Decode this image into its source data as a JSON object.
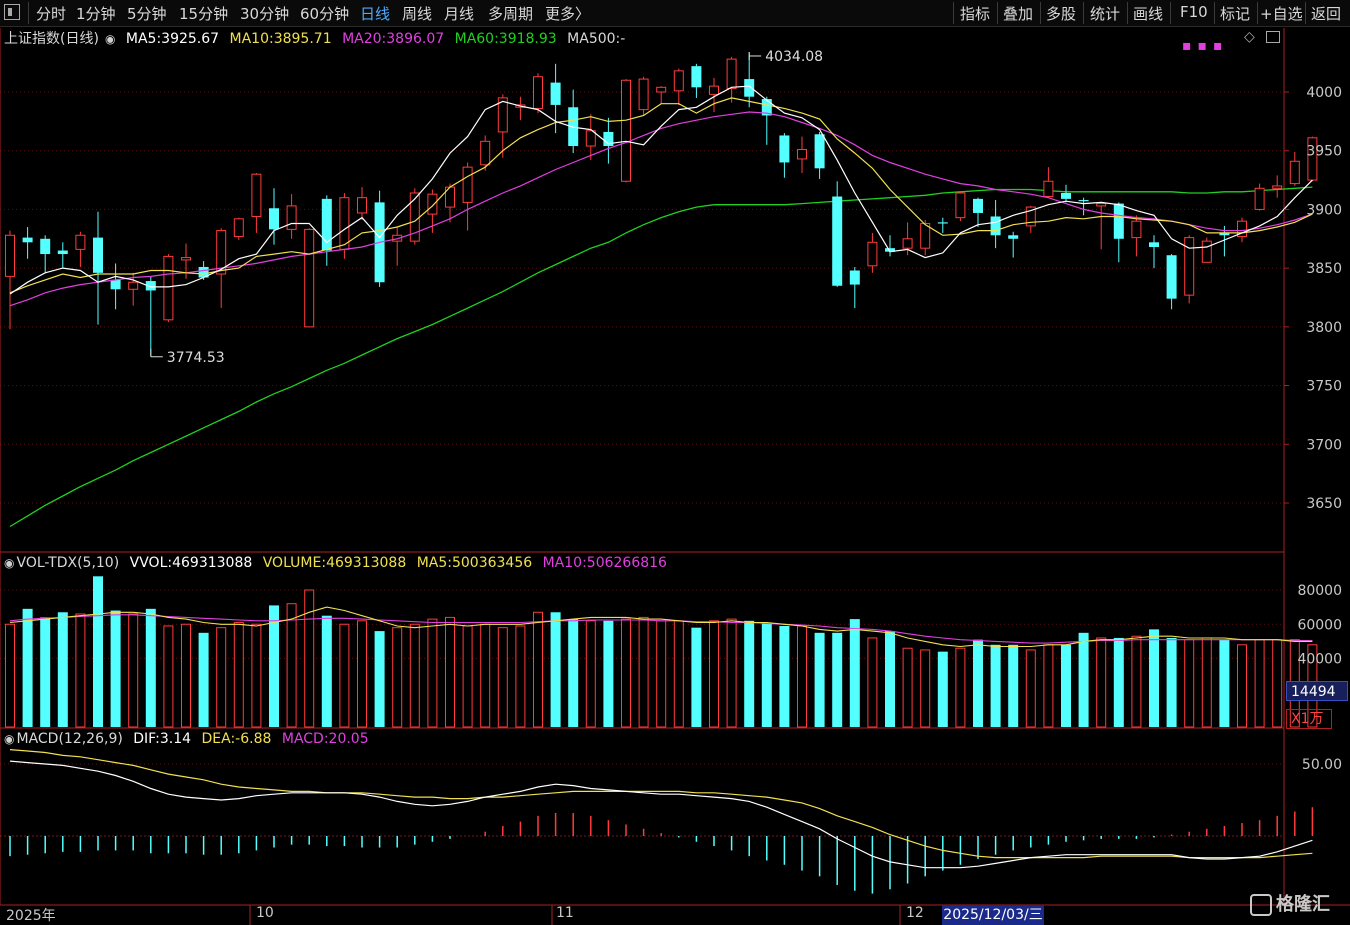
{
  "toolbar": {
    "periods": [
      "分时",
      "1分钟",
      "5分钟",
      "15分钟",
      "30分钟",
      "60分钟",
      "日线",
      "周线",
      "月线",
      "多周期",
      "更多〉"
    ],
    "active": "日线",
    "right": [
      "指标",
      "叠加",
      "多股",
      "统计",
      "画线",
      "F10",
      "标记",
      "+自选",
      "返回"
    ]
  },
  "colors": {
    "up": "#ff3b3b",
    "down": "#54ffff",
    "ma5": "#ffffff",
    "ma10": "#f0e050",
    "ma20": "#e040e0",
    "ma60": "#20d020",
    "macd_dif": "#ffffff",
    "macd_dea": "#f0e050"
  },
  "price_legend": {
    "name": "上证指数(日线)",
    "ma5_label": "MA5:",
    "ma5": "3925.67",
    "ma10_label": "MA10:",
    "ma10": "3895.71",
    "ma20_label": "MA20:",
    "ma20": "3896.07",
    "ma60_label": "MA60:",
    "ma60": "3918.93",
    "ma500_label": "MA500:",
    "ma500": "-"
  },
  "vol_legend": {
    "name": "VOL-TDX(5,10)",
    "vvol_label": "VVOL:",
    "vvol": "469313088",
    "volume_label": "VOLUME:",
    "volume": "469313088",
    "ma5_label": "MA5:",
    "ma5": "500363456",
    "ma10_label": "MA10:",
    "ma10": "506266816"
  },
  "macd_legend": {
    "name": "MACD(12,26,9)",
    "dif_label": "DIF:",
    "dif": "3.14",
    "dea_label": "DEA:",
    "dea": "-6.88",
    "macd_label": "MACD:",
    "macd": "20.05"
  },
  "annotations": {
    "high": "4034.08",
    "low": "3774.53"
  },
  "vol_box": "14494",
  "unit_box": "X1万",
  "x_labels": {
    "year": "2025年",
    "oct": "10",
    "nov": "11",
    "dec": "12"
  },
  "cursor_date": "2025/12/03/三",
  "logo_text": "格隆汇",
  "chart_data": {
    "type": "candlestick",
    "price_axis": {
      "ticks": [
        "4000",
        "3950",
        "3900",
        "3850",
        "3800",
        "3750",
        "3700",
        "3650"
      ],
      "ylim": [
        3625,
        4055
      ]
    },
    "volume_axis": {
      "ticks": [
        "80000",
        "60000",
        "40000"
      ],
      "ylim": [
        0,
        88000
      ]
    },
    "macd_axis": {
      "ticks": [
        "50.00"
      ]
    },
    "candles": [
      {
        "o": 3843,
        "c": 3878,
        "h": 3882,
        "l": 3798
      },
      {
        "o": 3876,
        "c": 3872,
        "h": 3885,
        "l": 3858
      },
      {
        "o": 3875,
        "c": 3862,
        "h": 3878,
        "l": 3846
      },
      {
        "o": 3865,
        "c": 3862,
        "h": 3872,
        "l": 3850
      },
      {
        "o": 3866,
        "c": 3878,
        "h": 3881,
        "l": 3851
      },
      {
        "o": 3876,
        "c": 3846,
        "h": 3898,
        "l": 3802
      },
      {
        "o": 3840,
        "c": 3832,
        "h": 3854,
        "l": 3815
      },
      {
        "o": 3832,
        "c": 3838,
        "h": 3846,
        "l": 3818
      },
      {
        "o": 3839,
        "c": 3831,
        "h": 3843,
        "l": 3775
      },
      {
        "o": 3806,
        "c": 3860,
        "h": 3862,
        "l": 3804
      },
      {
        "o": 3857,
        "c": 3859,
        "h": 3871,
        "l": 3841
      },
      {
        "o": 3851,
        "c": 3842,
        "h": 3856,
        "l": 3840
      },
      {
        "o": 3845,
        "c": 3882,
        "h": 3884,
        "l": 3816
      },
      {
        "o": 3877,
        "c": 3892,
        "h": 3893,
        "l": 3874
      },
      {
        "o": 3894,
        "c": 3930,
        "h": 3931,
        "l": 3880
      },
      {
        "o": 3901,
        "c": 3883,
        "h": 3918,
        "l": 3870
      },
      {
        "o": 3883,
        "c": 3903,
        "h": 3913,
        "l": 3875
      },
      {
        "o": 3800,
        "c": 3883,
        "h": 3884,
        "l": 3800
      },
      {
        "o": 3909,
        "c": 3865,
        "h": 3912,
        "l": 3852
      },
      {
        "o": 3866,
        "c": 3910,
        "h": 3914,
        "l": 3858
      },
      {
        "o": 3897,
        "c": 3910,
        "h": 3919,
        "l": 3891
      },
      {
        "o": 3906,
        "c": 3838,
        "h": 3916,
        "l": 3834
      },
      {
        "o": 3873,
        "c": 3878,
        "h": 3885,
        "l": 3852
      },
      {
        "o": 3873,
        "c": 3914,
        "h": 3918,
        "l": 3870
      },
      {
        "o": 3896,
        "c": 3913,
        "h": 3917,
        "l": 3880
      },
      {
        "o": 3902,
        "c": 3919,
        "h": 3922,
        "l": 3889
      },
      {
        "o": 3906,
        "c": 3936,
        "h": 3940,
        "l": 3882
      },
      {
        "o": 3938,
        "c": 3958,
        "h": 3963,
        "l": 3933
      },
      {
        "o": 3966,
        "c": 3995,
        "h": 3998,
        "l": 3944
      },
      {
        "o": 3987,
        "c": 3989,
        "h": 3996,
        "l": 3976
      },
      {
        "o": 3986,
        "c": 4013,
        "h": 4016,
        "l": 3982
      },
      {
        "o": 4008,
        "c": 3989,
        "h": 4024,
        "l": 3965
      },
      {
        "o": 3987,
        "c": 3954,
        "h": 4002,
        "l": 3948
      },
      {
        "o": 3954,
        "c": 3967,
        "h": 3981,
        "l": 3942
      },
      {
        "o": 3966,
        "c": 3954,
        "h": 3978,
        "l": 3939
      },
      {
        "o": 3924,
        "c": 4010,
        "h": 4011,
        "l": 3923
      },
      {
        "o": 3985,
        "c": 4011,
        "h": 4013,
        "l": 3980
      },
      {
        "o": 4000,
        "c": 4004,
        "h": 4005,
        "l": 3990
      },
      {
        "o": 4001,
        "c": 4018,
        "h": 4020,
        "l": 3989
      },
      {
        "o": 4022,
        "c": 4004,
        "h": 4024,
        "l": 3995
      },
      {
        "o": 3998,
        "c": 4005,
        "h": 4012,
        "l": 3983
      },
      {
        "o": 4003,
        "c": 4028,
        "h": 4030,
        "l": 3991
      },
      {
        "o": 4011,
        "c": 3996,
        "h": 4034,
        "l": 3987
      },
      {
        "o": 3994,
        "c": 3980,
        "h": 3996,
        "l": 3955
      },
      {
        "o": 3963,
        "c": 3940,
        "h": 3965,
        "l": 3927
      },
      {
        "o": 3943,
        "c": 3951,
        "h": 3962,
        "l": 3931
      },
      {
        "o": 3964,
        "c": 3935,
        "h": 3966,
        "l": 3926
      },
      {
        "o": 3911,
        "c": 3835,
        "h": 3924,
        "l": 3834
      },
      {
        "o": 3848,
        "c": 3836,
        "h": 3851,
        "l": 3816
      },
      {
        "o": 3852,
        "c": 3872,
        "h": 3880,
        "l": 3846
      },
      {
        "o": 3867,
        "c": 3864,
        "h": 3878,
        "l": 3860
      },
      {
        "o": 3867,
        "c": 3875,
        "h": 3889,
        "l": 3861
      },
      {
        "o": 3867,
        "c": 3888,
        "h": 3891,
        "l": 3861
      },
      {
        "o": 3889,
        "c": 3888,
        "h": 3893,
        "l": 3880
      },
      {
        "o": 3893,
        "c": 3914,
        "h": 3915,
        "l": 3890
      },
      {
        "o": 3909,
        "c": 3897,
        "h": 3910,
        "l": 3885
      },
      {
        "o": 3894,
        "c": 3878,
        "h": 3908,
        "l": 3867
      },
      {
        "o": 3878,
        "c": 3875,
        "h": 3881,
        "l": 3859
      },
      {
        "o": 3886,
        "c": 3902,
        "h": 3903,
        "l": 3880
      },
      {
        "o": 3911,
        "c": 3924,
        "h": 3936,
        "l": 3910
      },
      {
        "o": 3914,
        "c": 3909,
        "h": 3921,
        "l": 3906
      },
      {
        "o": 3908,
        "c": 3907,
        "h": 3910,
        "l": 3895
      },
      {
        "o": 3903,
        "c": 3905,
        "h": 3906,
        "l": 3866
      },
      {
        "o": 3905,
        "c": 3875,
        "h": 3906,
        "l": 3855
      },
      {
        "o": 3876,
        "c": 3890,
        "h": 3895,
        "l": 3860
      },
      {
        "o": 3872,
        "c": 3868,
        "h": 3878,
        "l": 3850
      },
      {
        "o": 3861,
        "c": 3824,
        "h": 3862,
        "l": 3815
      },
      {
        "o": 3827,
        "c": 3876,
        "h": 3878,
        "l": 3820
      },
      {
        "o": 3855,
        "c": 3873,
        "h": 3876,
        "l": 3855
      },
      {
        "o": 3880,
        "c": 3878,
        "h": 3886,
        "l": 3860
      },
      {
        "o": 3877,
        "c": 3890,
        "h": 3893,
        "l": 3872
      },
      {
        "o": 3900,
        "c": 3918,
        "h": 3922,
        "l": 3899
      },
      {
        "o": 3918,
        "c": 3920,
        "h": 3929,
        "l": 3910
      },
      {
        "o": 3922,
        "c": 3941,
        "h": 3949,
        "l": 3920
      },
      {
        "o": 3925,
        "c": 3961,
        "h": 3962,
        "l": 3924
      }
    ],
    "ma5": [
      3828,
      3838,
      3846,
      3850,
      3848,
      3838,
      3843,
      3840,
      3834,
      3834,
      3836,
      3842,
      3849,
      3858,
      3862,
      3882,
      3888,
      3888,
      3872,
      3883,
      3893,
      3876,
      3895,
      3909,
      3926,
      3948,
      3962,
      3985,
      3992,
      3988,
      3985,
      3975,
      3970,
      3968,
      3956,
      3958,
      3955,
      3971,
      3985,
      3987,
      3996,
      4004,
      4005,
      3993,
      3982,
      3978,
      3968,
      3942,
      3914,
      3889,
      3864,
      3866,
      3859,
      3863,
      3880,
      3887,
      3889,
      3895,
      3899,
      3904,
      3907,
      3905,
      3906,
      3904,
      3899,
      3895,
      3875,
      3867,
      3868,
      3874,
      3880,
      3886,
      3894,
      3910,
      3925
    ],
    "ma10": [
      3829,
      3835,
      3840,
      3845,
      3842,
      3845,
      3845,
      3845,
      3848,
      3848,
      3846,
      3845,
      3848,
      3850,
      3860,
      3862,
      3864,
      3862,
      3866,
      3870,
      3880,
      3882,
      3885,
      3890,
      3903,
      3919,
      3928,
      3936,
      3950,
      3961,
      3968,
      3974,
      3976,
      3979,
      3975,
      3976,
      3980,
      3990,
      3990,
      3982,
      3990,
      3995,
      3992,
      3989,
      3986,
      3982,
      3977,
      3960,
      3948,
      3935,
      3917,
      3902,
      3887,
      3878,
      3879,
      3882,
      3882,
      3887,
      3889,
      3890,
      3893,
      3892,
      3894,
      3894,
      3892,
      3891,
      3890,
      3887,
      3880,
      3880,
      3880,
      3882,
      3885,
      3889,
      3896
    ],
    "ma20": [
      3818,
      3823,
      3829,
      3833,
      3836,
      3838,
      3840,
      3842,
      3843,
      3845,
      3846,
      3848,
      3850,
      3852,
      3854,
      3857,
      3860,
      3862,
      3864,
      3866,
      3868,
      3872,
      3875,
      3880,
      3886,
      3892,
      3900,
      3907,
      3914,
      3920,
      3927,
      3934,
      3940,
      3946,
      3952,
      3957,
      3963,
      3969,
      3973,
      3976,
      3979,
      3981,
      3983,
      3982,
      3979,
      3974,
      3969,
      3963,
      3955,
      3946,
      3940,
      3935,
      3930,
      3926,
      3922,
      3920,
      3917,
      3915,
      3913,
      3910,
      3905,
      3900,
      3897,
      3895,
      3893,
      3892,
      3890,
      3887,
      3884,
      3882,
      3882,
      3884,
      3887,
      3891,
      3896
    ],
    "ma60": [
      3630,
      3639,
      3648,
      3656,
      3664,
      3671,
      3678,
      3686,
      3693,
      3700,
      3707,
      3714,
      3721,
      3728,
      3736,
      3743,
      3749,
      3756,
      3763,
      3769,
      3776,
      3783,
      3790,
      3796,
      3802,
      3809,
      3816,
      3823,
      3830,
      3838,
      3846,
      3853,
      3860,
      3867,
      3872,
      3880,
      3887,
      3893,
      3898,
      3902,
      3904,
      3904,
      3904,
      3904,
      3904,
      3905,
      3906,
      3907,
      3908,
      3909,
      3910,
      3911,
      3912,
      3914,
      3915,
      3916,
      3917,
      3917,
      3917,
      3916,
      3915,
      3915,
      3915,
      3915,
      3915,
      3915,
      3915,
      3914,
      3914,
      3915,
      3915,
      3916,
      3917,
      3918,
      3919
    ],
    "volume": [
      60000,
      69000,
      64000,
      67000,
      66000,
      88000,
      68000,
      66000,
      69000,
      59000,
      60000,
      55000,
      58000,
      61000,
      60000,
      71000,
      72000,
      80000,
      65000,
      60000,
      62000,
      56000,
      58000,
      60000,
      63000,
      64000,
      59000,
      60000,
      58000,
      59000,
      67000,
      67000,
      63000,
      62000,
      62000,
      63000,
      64000,
      62000,
      62000,
      58000,
      62000,
      63000,
      62000,
      61000,
      59000,
      59000,
      55000,
      55000,
      63000,
      52000,
      56000,
      46000,
      45000,
      44000,
      46000,
      51000,
      48000,
      48000,
      45000,
      48000,
      48000,
      55000,
      52000,
      52000,
      53000,
      57000,
      52000,
      51000,
      52000,
      51000,
      48000,
      51000,
      51000,
      51000,
      48000
    ],
    "vol_ma5": [
      61000,
      62000,
      63000,
      64000,
      65000,
      66000,
      67000,
      67000,
      66000,
      64000,
      63000,
      61000,
      60000,
      60000,
      59000,
      61000,
      63000,
      67000,
      70000,
      68000,
      65000,
      62000,
      59000,
      58000,
      59000,
      60000,
      59000,
      60000,
      60000,
      60000,
      61000,
      62000,
      63000,
      64000,
      64000,
      64000,
      63000,
      63000,
      62000,
      61000,
      61000,
      62000,
      61000,
      61000,
      60000,
      59000,
      57000,
      56000,
      57000,
      56000,
      55000,
      52000,
      50000,
      48000,
      47000,
      48000,
      47000,
      47000,
      47000,
      48000,
      48000,
      50000,
      51000,
      51000,
      52000,
      53000,
      53000,
      52000,
      52000,
      52000,
      51000,
      51000,
      51000,
      50000,
      50000
    ],
    "vol_ma10": [
      62000,
      63000,
      63500,
      64000,
      64500,
      65000,
      65500,
      65500,
      65000,
      64500,
      64000,
      63500,
      63000,
      62500,
      62000,
      62000,
      62500,
      63000,
      63500,
      63500,
      63000,
      62500,
      62000,
      61500,
      61000,
      61000,
      61000,
      61000,
      61000,
      61000,
      61500,
      62000,
      62000,
      62500,
      62500,
      62500,
      62500,
      62000,
      62000,
      61500,
      61500,
      61000,
      61000,
      60500,
      60000,
      59500,
      59000,
      58000,
      57500,
      57000,
      56000,
      54500,
      53000,
      52000,
      51000,
      50500,
      50000,
      49500,
      49000,
      49000,
      49500,
      50000,
      50500,
      50500,
      51000,
      51000,
      51000,
      51000,
      51000,
      51000,
      51000,
      51000,
      51000,
      50500,
      50500
    ],
    "macd_hist": [
      -14,
      -13,
      -12,
      -11,
      -11,
      -10,
      -10,
      -10,
      -12,
      -12,
      -12,
      -13,
      -13,
      -12,
      -10,
      -8,
      -6,
      -6,
      -7,
      -7,
      -8,
      -8,
      -8,
      -6,
      -4,
      -2,
      0,
      3,
      7,
      10,
      14,
      16,
      16,
      14,
      11,
      8,
      5,
      2,
      -1,
      -4,
      -7,
      -10,
      -14,
      -17,
      -20,
      -24,
      -28,
      -34,
      -38,
      -40,
      -37,
      -33,
      -28,
      -24,
      -20,
      -16,
      -13,
      -10,
      -8,
      -6,
      -4,
      -3,
      -2,
      -2,
      -2,
      -1,
      1,
      3,
      5,
      7,
      9,
      11,
      14,
      17,
      20
    ],
    "macd_dif": [
      52,
      51,
      50,
      49,
      47,
      45,
      42,
      38,
      33,
      29,
      27,
      26,
      25,
      26,
      28,
      29,
      30,
      30,
      30,
      30,
      29,
      27,
      24,
      22,
      21,
      22,
      24,
      27,
      29,
      31,
      34,
      36,
      35,
      33,
      32,
      31,
      30,
      29,
      29,
      28,
      27,
      26,
      24,
      20,
      15,
      10,
      5,
      -2,
      -8,
      -14,
      -18,
      -20,
      -22,
      -22,
      -22,
      -21,
      -19,
      -17,
      -15,
      -14,
      -13,
      -13,
      -13,
      -13,
      -13,
      -13,
      -13,
      -15,
      -16,
      -16,
      -15,
      -14,
      -11,
      -7,
      -3
    ],
    "macd_dea": [
      60,
      59,
      58,
      56,
      55,
      53,
      51,
      49,
      46,
      43,
      41,
      39,
      36,
      34,
      33,
      32,
      31,
      31,
      30,
      30,
      30,
      29,
      28,
      27,
      27,
      26,
      26,
      27,
      27,
      28,
      29,
      30,
      31,
      31,
      31,
      31,
      31,
      31,
      31,
      30,
      30,
      29,
      28,
      27,
      25,
      23,
      19,
      14,
      10,
      6,
      1,
      -3,
      -7,
      -10,
      -12,
      -14,
      -15,
      -15,
      -15,
      -15,
      -15,
      -15,
      -14,
      -14,
      -14,
      -14,
      -14,
      -15,
      -15,
      -15,
      -15,
      -15,
      -14,
      -13,
      -12
    ]
  }
}
